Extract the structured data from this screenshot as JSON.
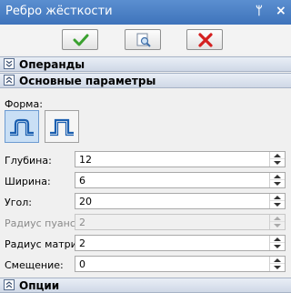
{
  "window": {
    "title": "Ребро жёсткости",
    "pin_glyph": "ᛘ",
    "close_glyph": "×"
  },
  "toolbar": {
    "ok_icon": "checkmark-icon",
    "preview_icon": "preview-icon",
    "cancel_icon": "red-x-icon",
    "accent_ok": "#3aa12f",
    "accent_cancel": "#d42020"
  },
  "sections": {
    "operands": {
      "label": "Операнды",
      "state": "collapsed"
    },
    "main_params": {
      "label": "Основные параметры",
      "state": "expanded"
    },
    "options": {
      "label": "Опции",
      "state": "expanded"
    }
  },
  "shape": {
    "label": "Форма:",
    "options": [
      {
        "icon": "rounded-profile-icon",
        "selected": true
      },
      {
        "icon": "square-profile-icon",
        "selected": false
      }
    ]
  },
  "fields": [
    {
      "label": "Глубина:",
      "value": "12",
      "disabled": false
    },
    {
      "label": "Ширина:",
      "value": "6",
      "disabled": false
    },
    {
      "label": "Угол:",
      "value": "20",
      "disabled": false
    },
    {
      "label": "Радиус пуансона:",
      "value": "2",
      "disabled": true
    },
    {
      "label": "Радиус матрицы:",
      "value": "2",
      "disabled": false
    },
    {
      "label": "Смещение:",
      "value": "0",
      "disabled": false
    }
  ]
}
